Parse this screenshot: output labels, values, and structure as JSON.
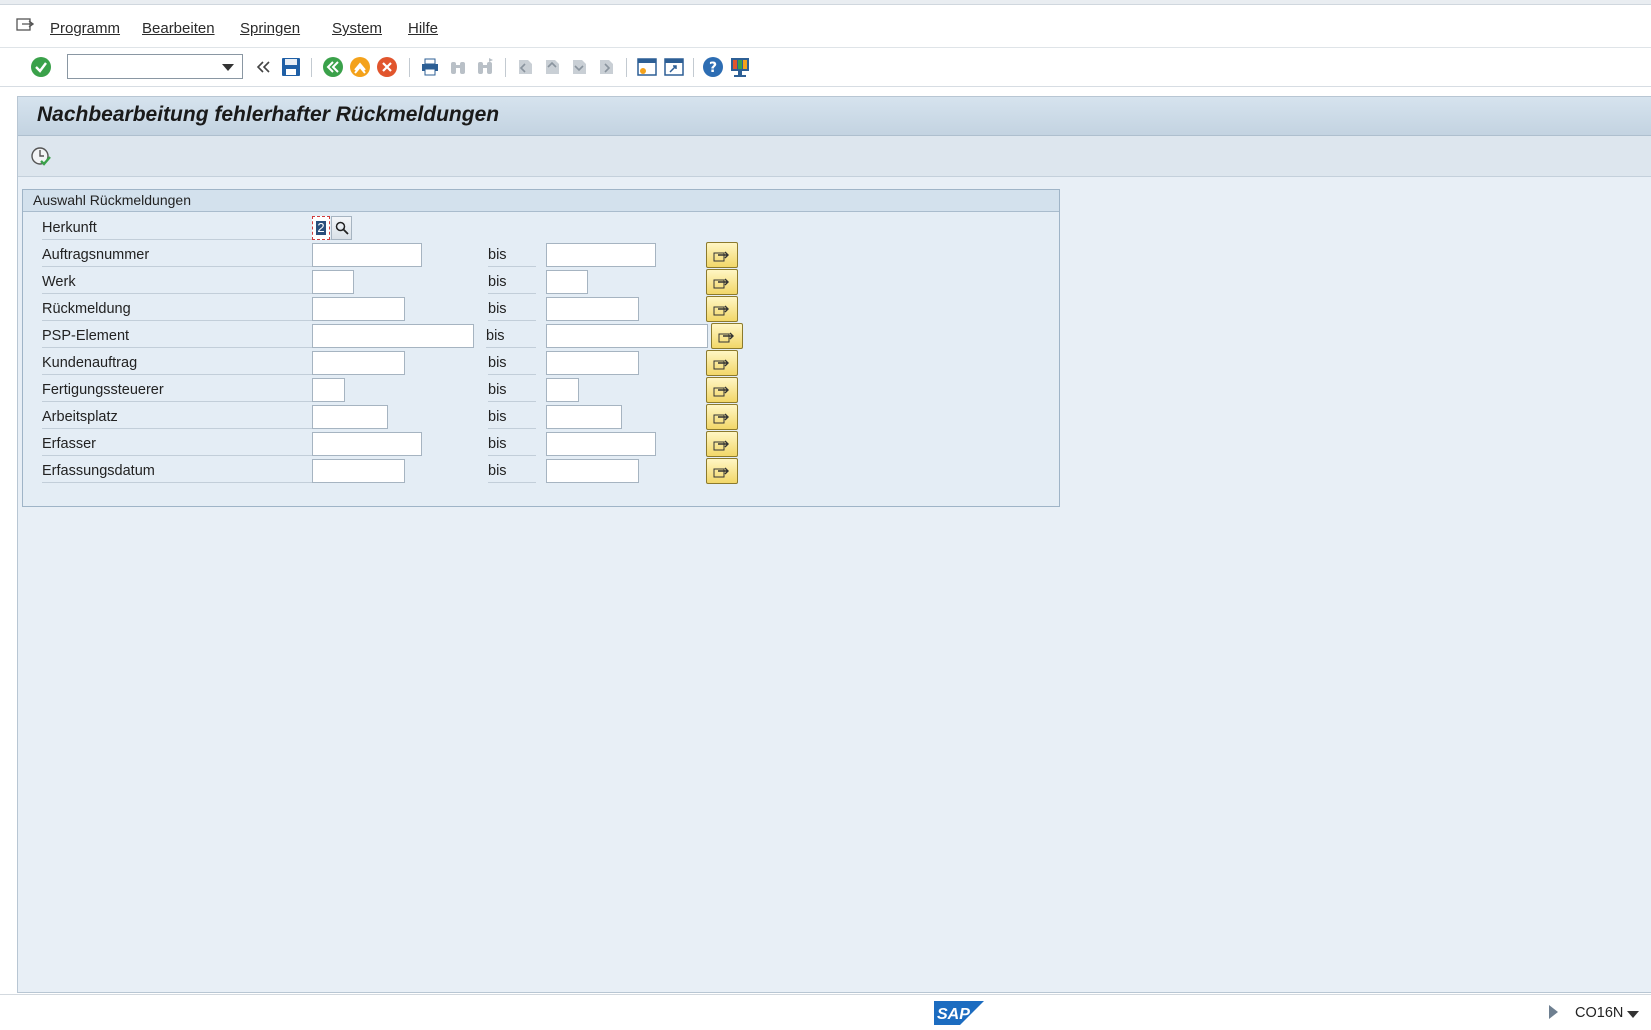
{
  "menu": {
    "items": [
      {
        "label": "Programm"
      },
      {
        "label": "Bearbeiten"
      },
      {
        "label": "Springen"
      },
      {
        "label": "System"
      },
      {
        "label": "Hilfe"
      }
    ]
  },
  "toolbar": {
    "command_field_value": "",
    "icons": [
      "enter-icon",
      "command-dropdown",
      "collapse-arrows-icon",
      "save-icon",
      "back-icon",
      "exit-icon",
      "cancel-icon",
      "print-icon",
      "find-icon",
      "find-next-icon",
      "first-page-icon",
      "previous-page-icon",
      "next-page-icon",
      "last-page-icon",
      "create-session-icon",
      "generate-shortcut-icon",
      "help-icon",
      "customize-layout-icon"
    ]
  },
  "screen": {
    "title": "Nachbearbeitung fehlerhafter Rückmeldungen"
  },
  "selection": {
    "group_title": "Auswahl Rückmeldungen",
    "to_label": "bis",
    "herkunft": {
      "label": "Herkunft",
      "value": "2"
    },
    "rows": [
      {
        "label": "Auftragsnummer"
      },
      {
        "label": "Werk"
      },
      {
        "label": "Rückmeldung"
      },
      {
        "label": "PSP-Element"
      },
      {
        "label": "Kundenauftrag"
      },
      {
        "label": "Fertigungssteuerer"
      },
      {
        "label": "Arbeitsplatz"
      },
      {
        "label": "Erfasser"
      },
      {
        "label": "Erfassungsdatum"
      }
    ]
  },
  "status": {
    "logo_text": "SAP",
    "transaction": "CO16N"
  },
  "colors": {
    "main_background": "#e8eff6",
    "multi_select_button": "#f2d769",
    "enter_green": "#3aa14a"
  }
}
